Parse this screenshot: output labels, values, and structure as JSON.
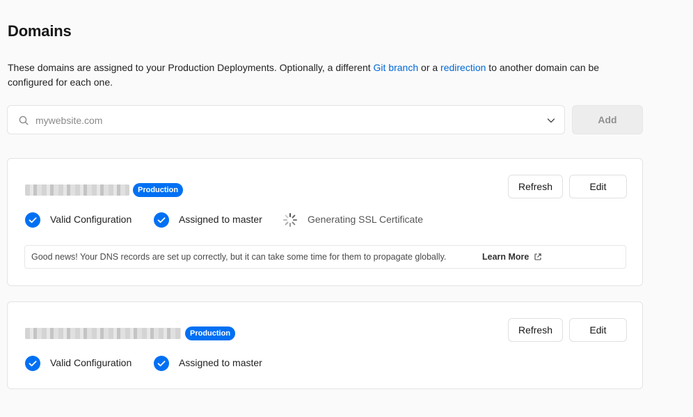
{
  "page": {
    "title": "Domains",
    "description_prefix": "These domains are assigned to your Production Deployments. Optionally, a different ",
    "link_git_branch": "Git branch",
    "description_middle": " or a ",
    "link_redirection": "redirection",
    "description_suffix": " to another domain can be configured for each one."
  },
  "search": {
    "placeholder": "mywebsite.com",
    "value": "",
    "icon": "search-icon",
    "dropdown_icon": "chevron-down-icon"
  },
  "add_button": {
    "label": "Add"
  },
  "colors": {
    "link": "#0068d6",
    "badge": "#0070f3",
    "check": "#0070f3"
  },
  "domains": [
    {
      "name": "",
      "badge": "Production",
      "refresh_label": "Refresh",
      "edit_label": "Edit",
      "statuses": [
        {
          "label": "Valid Configuration",
          "icon": "check-circle-icon"
        },
        {
          "label": "Assigned to master",
          "icon": "check-circle-icon"
        },
        {
          "label": "Generating SSL Certificate",
          "icon": "spinner-icon"
        }
      ],
      "info": {
        "text": "Good news! Your DNS records are set up correctly, but it can take some time for them to propagate globally.",
        "link_label": "Learn More",
        "link_icon": "external-link-icon"
      }
    },
    {
      "name": "",
      "badge": "Production",
      "refresh_label": "Refresh",
      "edit_label": "Edit",
      "statuses": [
        {
          "label": "Valid Configuration",
          "icon": "check-circle-icon"
        },
        {
          "label": "Assigned to master",
          "icon": "check-circle-icon"
        }
      ]
    }
  ]
}
